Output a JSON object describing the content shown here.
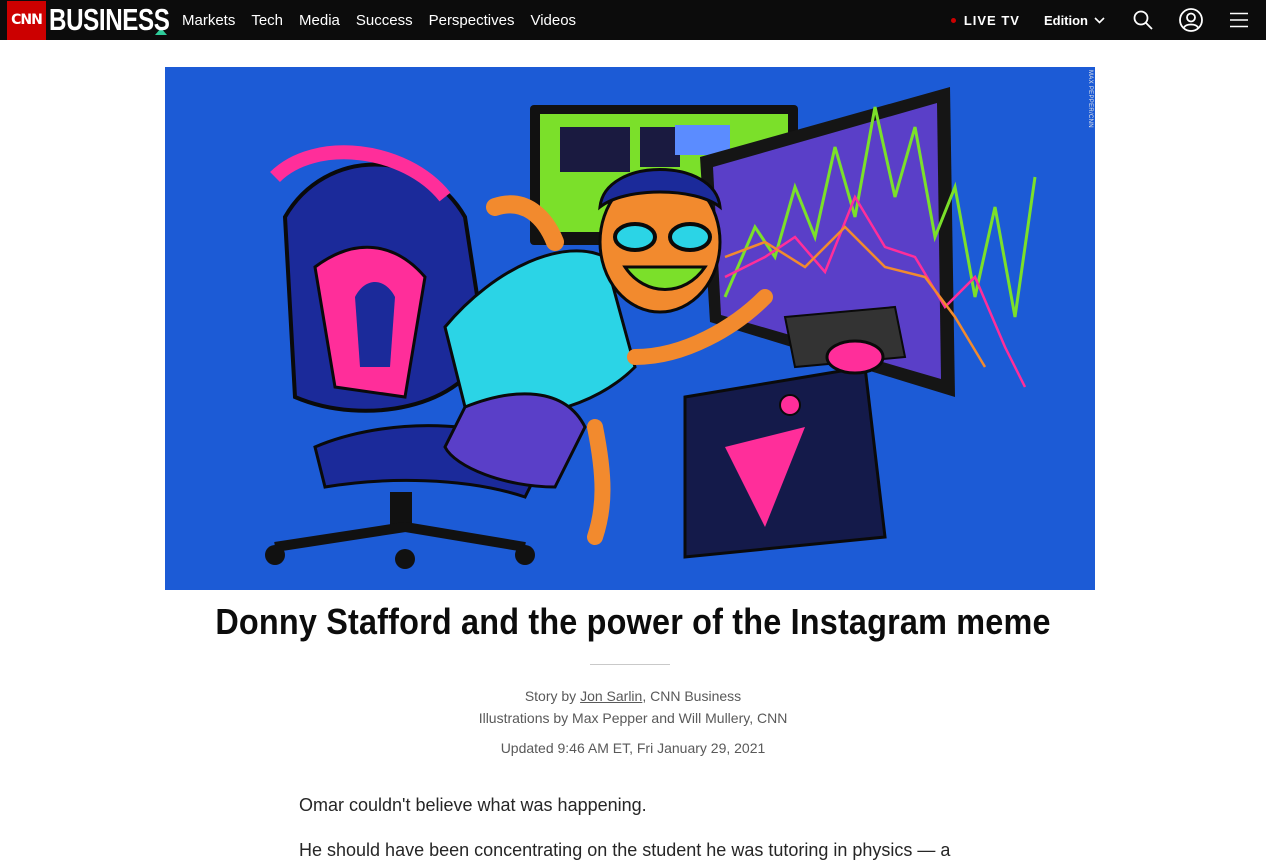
{
  "header": {
    "logo_cnn": "CNN",
    "logo_business": "BUSINESS",
    "nav": [
      "Markets",
      "Tech",
      "Media",
      "Success",
      "Perspectives",
      "Videos"
    ],
    "live_tv": "LIVE TV",
    "edition": "Edition"
  },
  "hero": {
    "credit": "MAX PEPPER/CNN",
    "colors": {
      "background": "#1c5bd6",
      "screen_green": "#7be02a",
      "accent_pink": "#ff2e9a",
      "skin_orange": "#f28a2e"
    }
  },
  "article": {
    "headline": "Donny Stafford and the power of the Instagram meme",
    "byline_prefix": "Story by ",
    "author": "Jon Sarlin",
    "byline_suffix": ", CNN Business",
    "illustrations": "Illustrations by Max Pepper and Will Mullery, CNN",
    "updated": "Updated 9:46 AM ET, Fri January 29, 2021",
    "paragraphs": [
      "Omar couldn't believe what was happening.",
      "He should have been concentrating on the student he was tutoring in physics — a"
    ]
  },
  "icons": [
    "search-icon",
    "account-icon",
    "menu-icon",
    "chevron-down-icon"
  ]
}
